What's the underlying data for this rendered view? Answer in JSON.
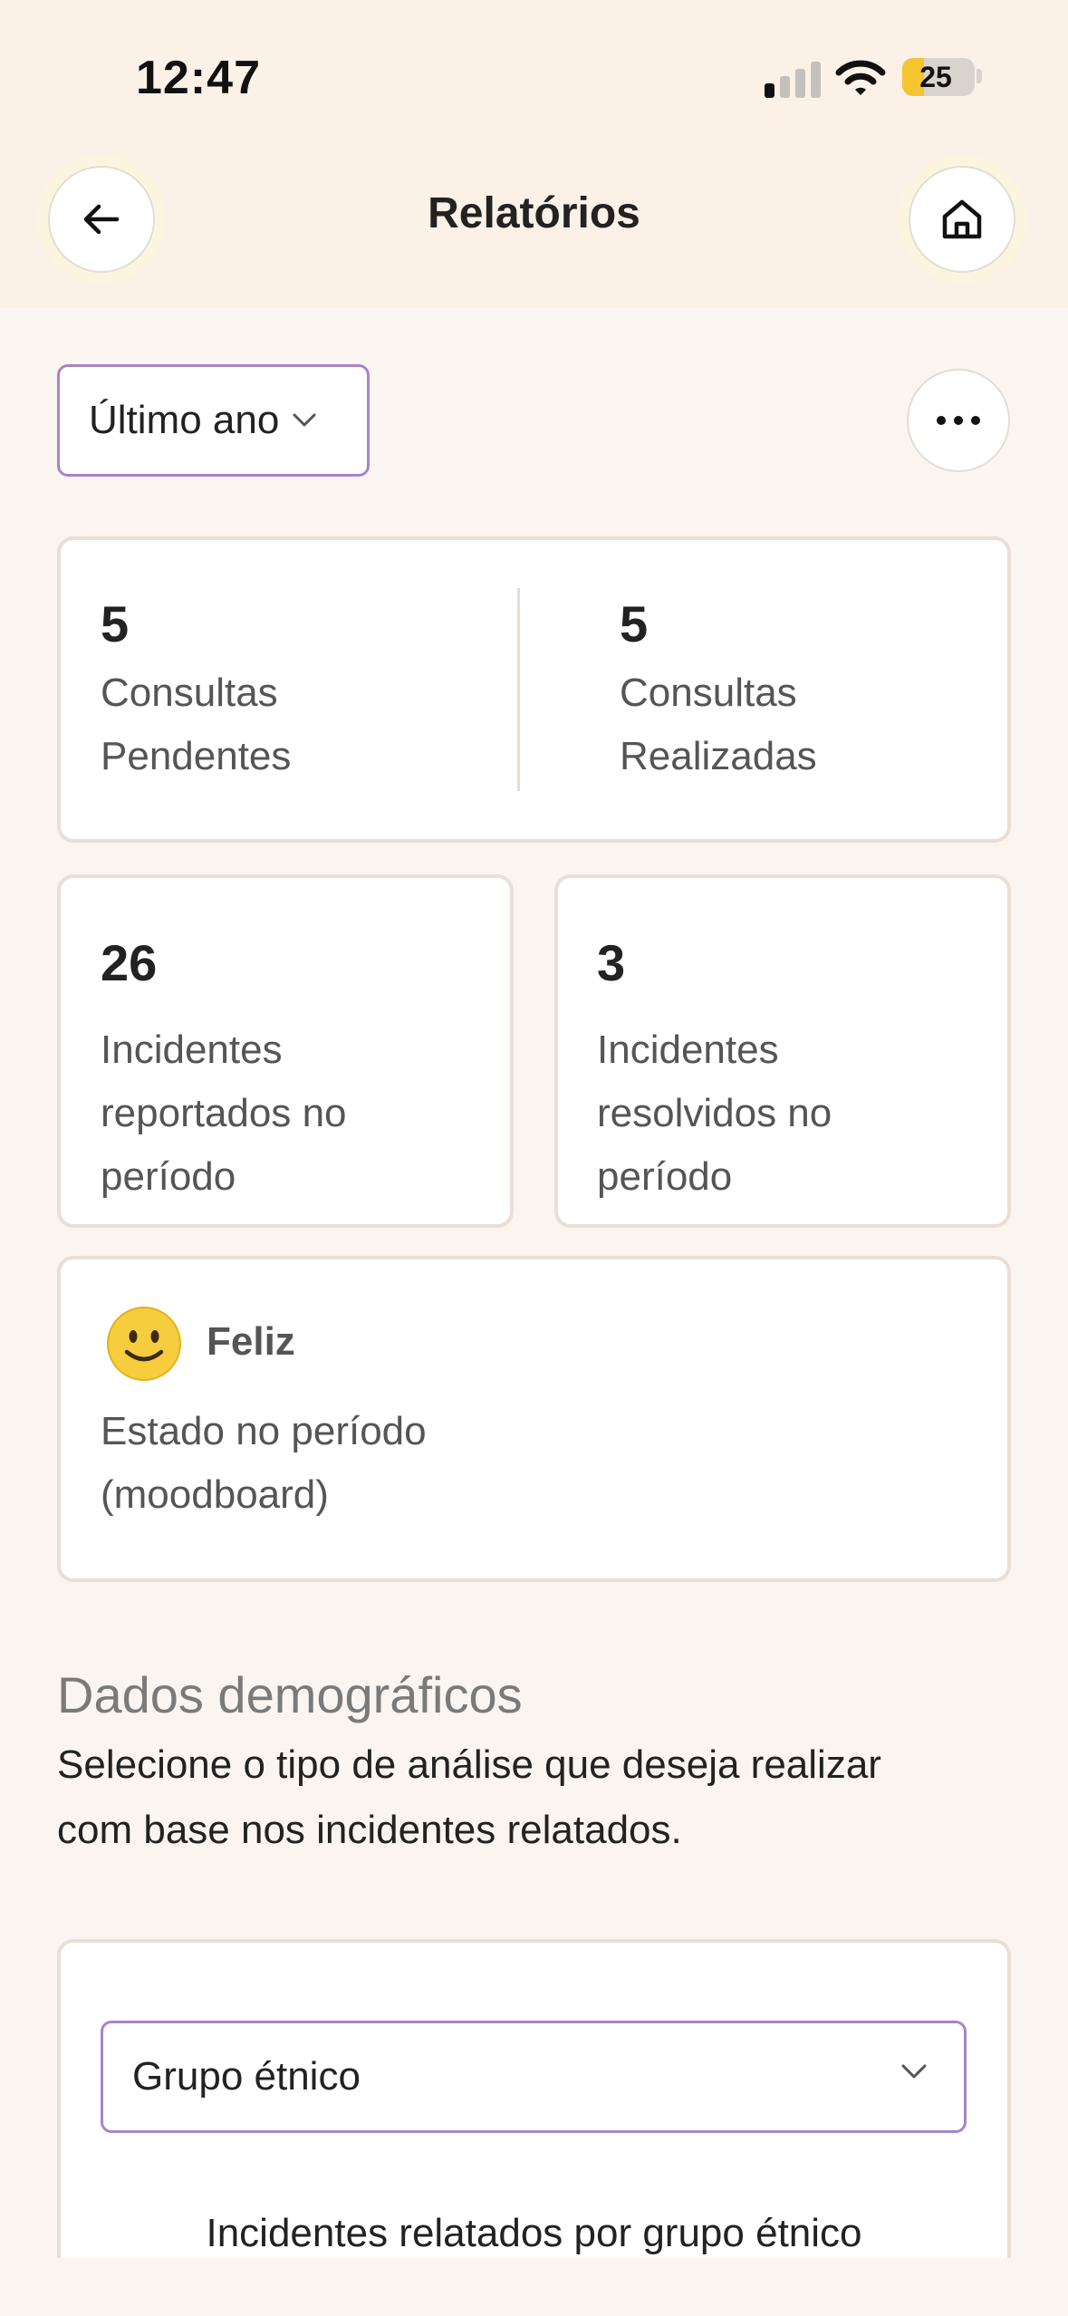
{
  "status_bar": {
    "time": "12:47",
    "battery": "25"
  },
  "header": {
    "title": "Relatórios"
  },
  "controls": {
    "period_selected": "Último ano"
  },
  "stats": {
    "pending": {
      "value": "5",
      "label_line1": "Consultas",
      "label_line2": "Pendentes"
    },
    "completed": {
      "value": "5",
      "label_line1": "Consultas",
      "label_line2": "Realizadas"
    },
    "incidents_reported": {
      "value": "26",
      "label_line1": "Incidentes",
      "label_line2": "reportados no",
      "label_line3": "período"
    },
    "incidents_resolved": {
      "value": "3",
      "label_line1": "Incidentes",
      "label_line2": "resolvidos no",
      "label_line3": "período"
    }
  },
  "mood": {
    "icon": "smiling-face-icon",
    "title": "Feliz",
    "label_line1": "Estado no período",
    "label_line2": "(moodboard)"
  },
  "demographics": {
    "title": "Dados demográficos",
    "description_line1": "Selecione o tipo de análise que deseja realizar",
    "description_line2": "com base nos incidentes relatados.",
    "analysis_selected": "Grupo étnico",
    "chart_heading": "Incidentes relatados por grupo étnico"
  },
  "colors": {
    "accent": "#a784c8",
    "background": "#faf5f0",
    "header_bg": "#fcf1e7",
    "card_border": "#e9dfd6",
    "emoji": "#f6cd3f"
  }
}
